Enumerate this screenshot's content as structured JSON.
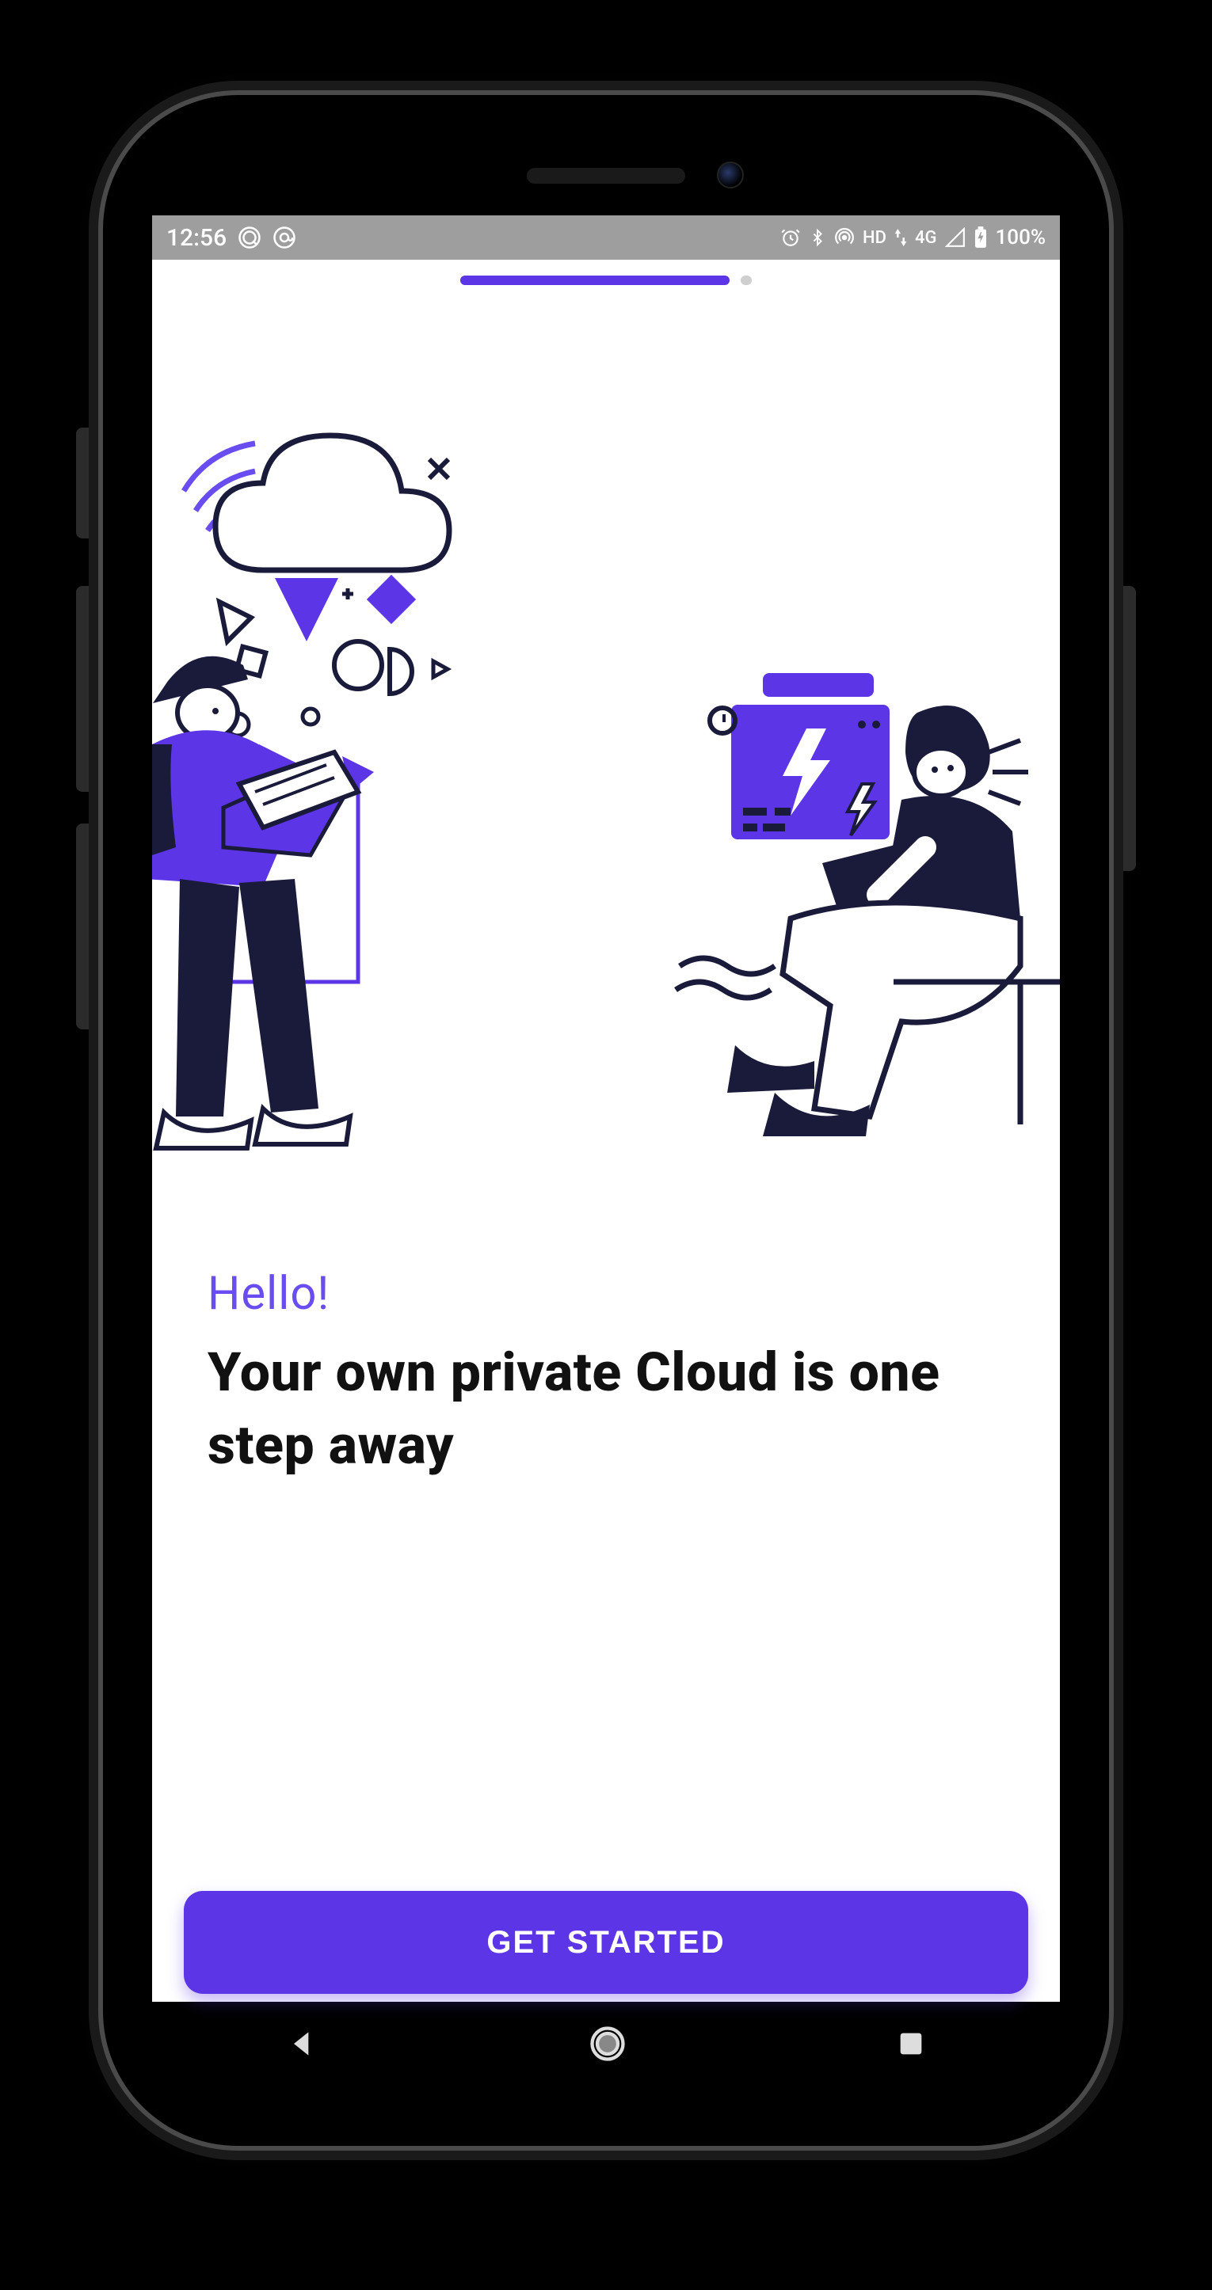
{
  "status_bar": {
    "time": "12:56",
    "left_icons": [
      "q-circle-icon",
      "at-circle-icon"
    ],
    "right_icons": [
      "alarm-icon",
      "bluetooth-icon",
      "hotspot-icon"
    ],
    "network_label_1": "HD",
    "network_label_2": "4G",
    "battery_text": "100%"
  },
  "pager": {
    "total": 2,
    "active_index": 0
  },
  "onboarding": {
    "greeting": "Hello!",
    "headline": "Your own private Cloud is one step away",
    "cta_label": "GET STARTED"
  },
  "colors": {
    "accent": "#5b35e6",
    "dark_navy": "#1a1a3a"
  },
  "nav_bar": {
    "items": [
      "back",
      "home",
      "recent"
    ]
  }
}
